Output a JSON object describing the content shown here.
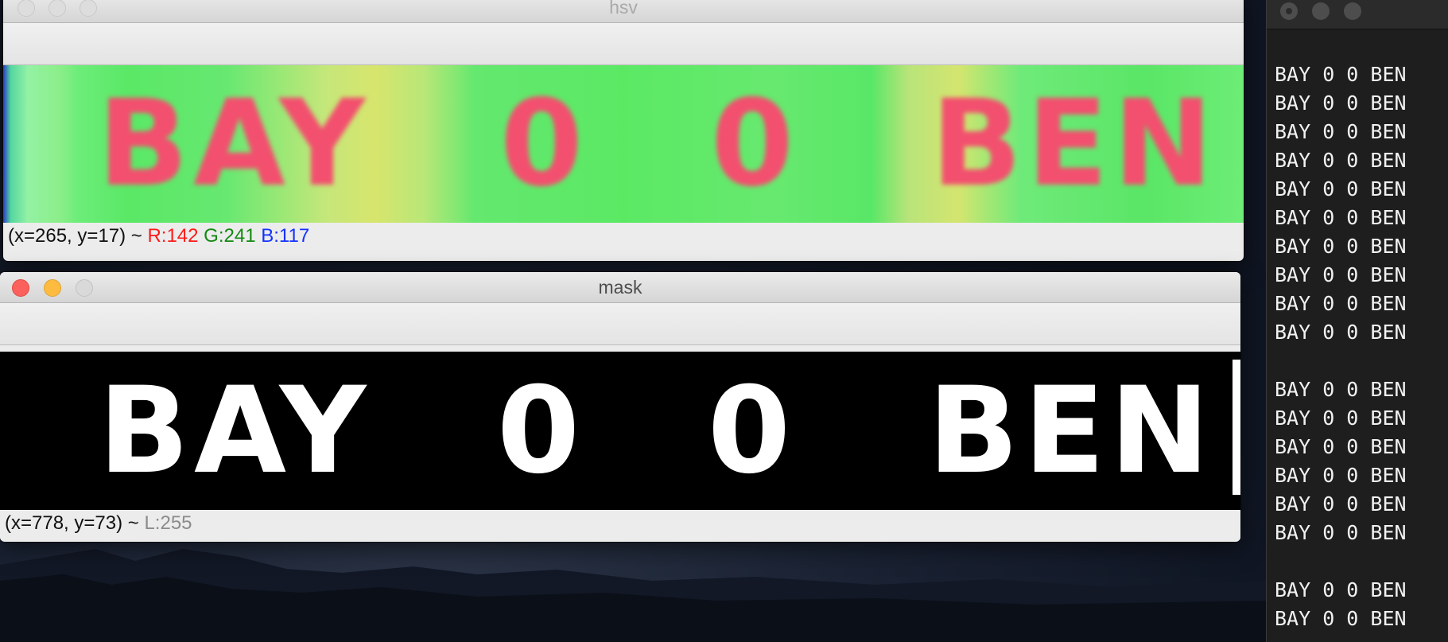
{
  "hsv_window": {
    "title": "hsv",
    "image_text": [
      "BAY",
      "0",
      "0",
      "BEN"
    ],
    "status": {
      "coords": "(x=265, y=17) ~",
      "r": "R:142",
      "g": "G:241",
      "b": "B:117"
    }
  },
  "mask_window": {
    "title": "mask",
    "image_text": [
      "BAY",
      "0",
      "0",
      "BEN"
    ],
    "status": {
      "coords": "(x=778, y=73) ~",
      "l": "L:255"
    }
  },
  "terminal": {
    "lines": [
      "BAY 0 0 BEN",
      "BAY 0 0 BEN",
      "BAY 0 0 BEN",
      "BAY 0 0 BEN",
      "BAY 0 0 BEN",
      "BAY 0 0 BEN",
      "BAY 0 0 BEN",
      "BAY 0 0 BEN",
      "BAY 0 0 BEN",
      "BAY 0 0 BEN",
      "",
      "BAY 0 0 BEN",
      "BAY 0 0 BEN",
      "BAY 0 0 BEN",
      "BAY 0 0 BEN",
      "BAY 0 0 BEN",
      "BAY 0 0 BEN",
      "",
      "BAY 0 0 BEN",
      "BAY 0 0 BEN"
    ]
  },
  "colors": {
    "hsv_letters": "#f2506e",
    "hsv_background": "#5ae866",
    "mask_background": "#000000",
    "mask_letters": "#ffffff"
  }
}
